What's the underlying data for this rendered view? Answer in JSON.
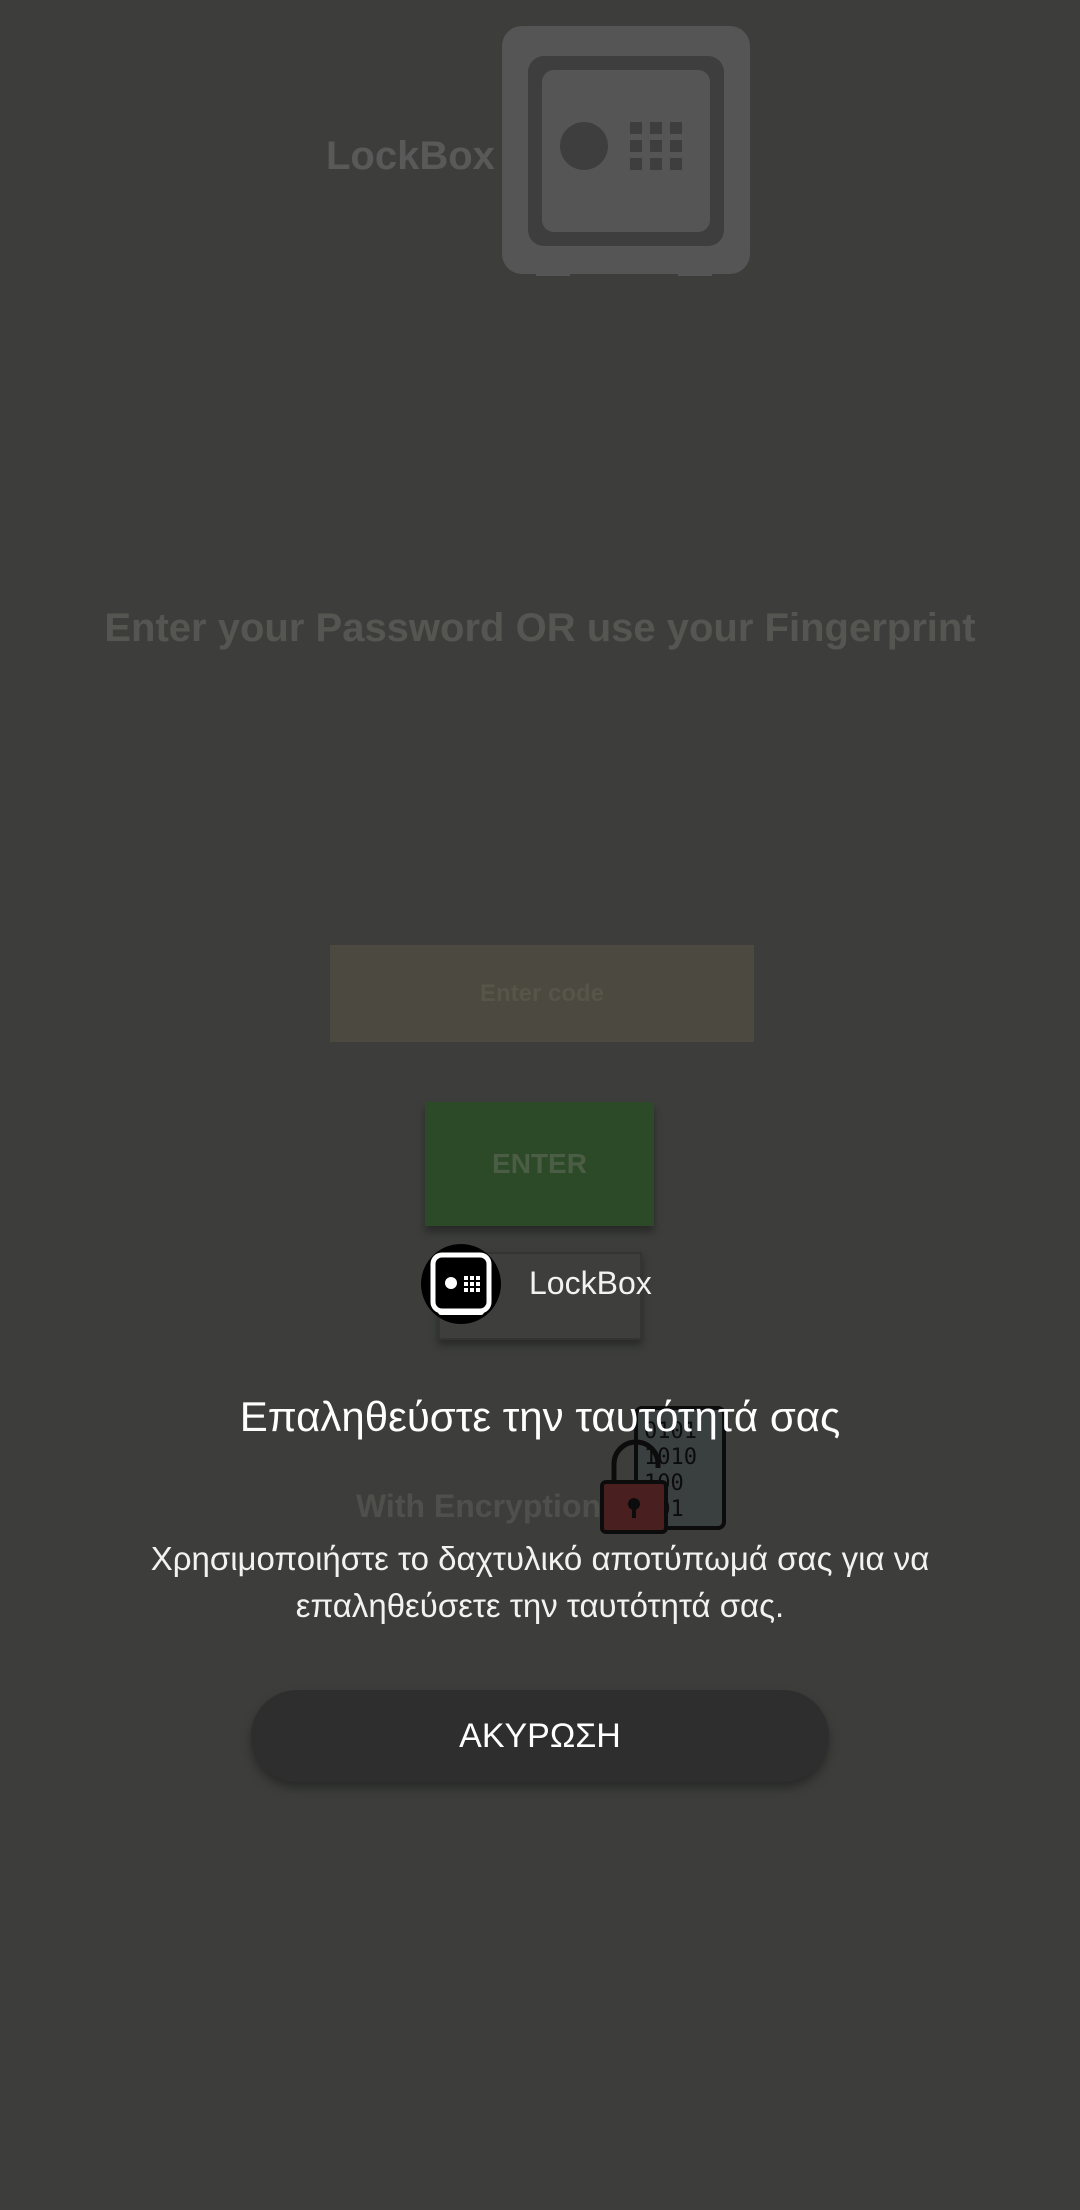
{
  "app": {
    "title": "LockBox",
    "prompt": "Enter your Password OR use your Fingerprint",
    "password_placeholder": "Enter code",
    "enter_label": "ENTER",
    "encryption_label": "With Encryption"
  },
  "dialog": {
    "app_name": "LockBox",
    "title": "Επαληθεύστε την ταυτότητά σας",
    "description": "Χρησιμοποιήστε το δαχτυλικό αποτύπωμά σας για να επαληθεύσετε την ταυτότητά σας.",
    "cancel_label": "ΑΚΥΡΩΣΗ"
  },
  "icons": {
    "app_logo": "safe-icon",
    "dialog_app_icon": "safe-icon",
    "encryption_icon": "padlock-binary-document-icon"
  },
  "colors": {
    "scrim_background": "#3d3e3c",
    "enter_button": "#2c4a27",
    "cancel_button": "#2e2e2e"
  }
}
